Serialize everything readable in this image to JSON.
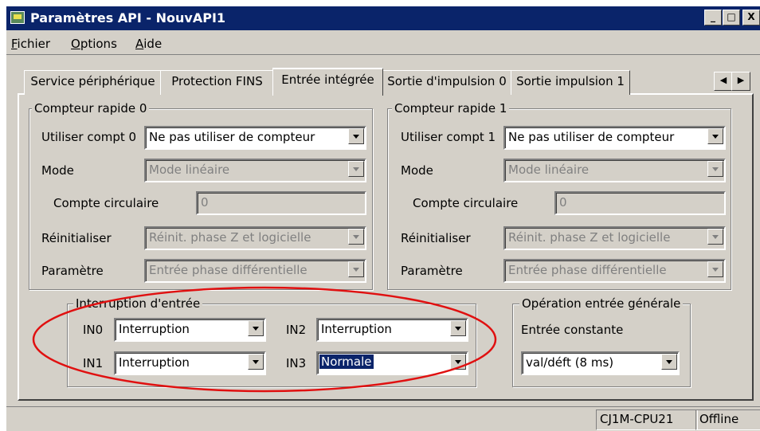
{
  "window": {
    "title": "Paramètres API - NouvAPI1",
    "caption_buttons": [
      "minimize-icon",
      "maximize-icon",
      "close-icon"
    ]
  },
  "menu": {
    "items": [
      {
        "accel": "F",
        "rest": "ichier"
      },
      {
        "accel": "O",
        "rest": "ptions"
      },
      {
        "accel": "A",
        "rest": "ide"
      }
    ]
  },
  "tabs": [
    {
      "label": "Service périphérique",
      "active": false
    },
    {
      "label": "Protection FINS",
      "active": false
    },
    {
      "label": "Entrée intégrée",
      "active": true
    },
    {
      "label": "Sortie d'impulsion 0",
      "active": false
    },
    {
      "label": "Sortie impulsion 1",
      "active": false
    }
  ],
  "counter0": {
    "title": "Compteur rapide 0",
    "use_label": "Utiliser compt 0",
    "use_value": "Ne pas utiliser de compteur",
    "mode_label": "Mode",
    "mode_value": "Mode linéaire",
    "circular_label": "Compte circulaire",
    "circular_value": "0",
    "reset_label": "Réinitialiser",
    "reset_value": "Réinit. phase Z et logicielle",
    "param_label": "Paramètre",
    "param_value": "Entrée phase différentielle"
  },
  "counter1": {
    "title": "Compteur rapide 1",
    "use_label": "Utiliser compt 1",
    "use_value": "Ne pas utiliser de compteur",
    "mode_label": "Mode",
    "mode_value": "Mode linéaire",
    "circular_label": "Compte circulaire",
    "circular_value": "0",
    "reset_label": "Réinitialiser",
    "reset_value": "Réinit. phase Z et logicielle",
    "param_label": "Paramètre",
    "param_value": "Entrée phase différentielle"
  },
  "interrupt": {
    "title": "Interruption d'entrée",
    "in0_label": "IN0",
    "in0_value": "Interruption",
    "in1_label": "IN1",
    "in1_value": "Interruption",
    "in2_label": "IN2",
    "in2_value": "Interruption",
    "in3_label": "IN3",
    "in3_value": "Normale"
  },
  "general_input": {
    "title": "Opération entrée générale",
    "const_label": "Entrée constante",
    "const_value": "val/déft (8 ms)"
  },
  "status": {
    "model": "CJ1M-CPU21",
    "connection": "Offline"
  },
  "colors": {
    "face": "#d4d0c8",
    "title_bar": "#0a246a",
    "highlight_ellipse": "#e01010"
  }
}
